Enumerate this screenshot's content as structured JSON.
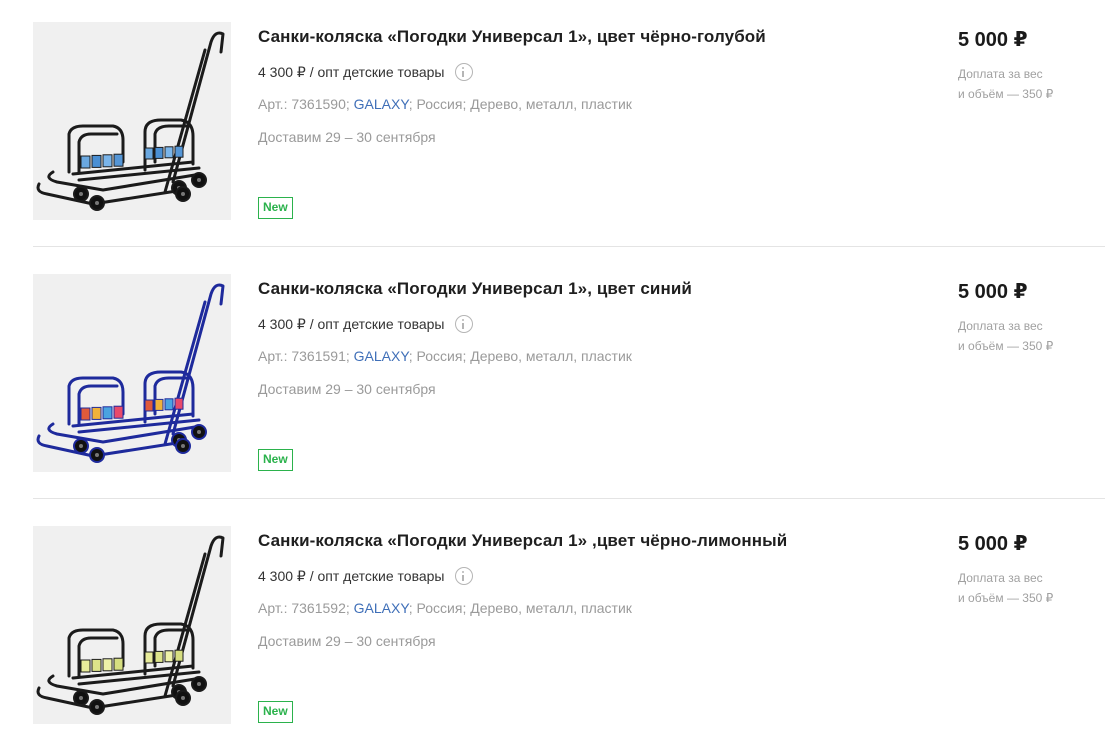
{
  "products": [
    {
      "title": "Санки-коляска «Погодки Универсал 1», цвет чёрно-голубой",
      "opt_price": "4 300 ₽ / опт детские товары",
      "article_prefix": "Арт.: 7361590;",
      "brand": "GALAXY",
      "article_suffix": "; Россия; Дерево, металл, пластик",
      "delivery": "Доставим 29 – 30 сентября",
      "badge": "New",
      "price": "5 000 ₽",
      "surcharge_line1": "Доплата за вес",
      "surcharge_line2": "и объём — 350 ₽",
      "frame_color": "#1b1b1b",
      "slat_colors": [
        "#6aa8e0",
        "#4a8fd3",
        "#7ab5ea",
        "#5596d6"
      ]
    },
    {
      "title": "Санки-коляска «Погодки Универсал 1», цвет синий",
      "opt_price": "4 300 ₽ / опт детские товары",
      "article_prefix": "Арт.: 7361591;",
      "brand": "GALAXY",
      "article_suffix": "; Россия; Дерево, металл, пластик",
      "delivery": "Доставим 29 – 30 сентября",
      "badge": "New",
      "price": "5 000 ₽",
      "surcharge_line1": "Доплата за вес",
      "surcharge_line2": "и объём — 350 ₽",
      "frame_color": "#1e2a9c",
      "slat_colors": [
        "#e05a3a",
        "#f0b23a",
        "#4aa3e0",
        "#e84a6a"
      ]
    },
    {
      "title": "Санки-коляска «Погодки Универсал 1» ,цвет чёрно-лимонный",
      "opt_price": "4 300 ₽ / опт детские товары",
      "article_prefix": "Арт.: 7361592;",
      "brand": "GALAXY",
      "article_suffix": "; Россия; Дерево, металл, пластик",
      "delivery": "Доставим 29 – 30 сентября",
      "badge": "New",
      "price": "5 000 ₽",
      "surcharge_line1": "Доплата за вес",
      "surcharge_line2": "и объём — 350 ₽",
      "frame_color": "#1b1b1b",
      "slat_colors": [
        "#e8ec9a",
        "#dde48a",
        "#eef2a8",
        "#d6de80"
      ]
    }
  ]
}
